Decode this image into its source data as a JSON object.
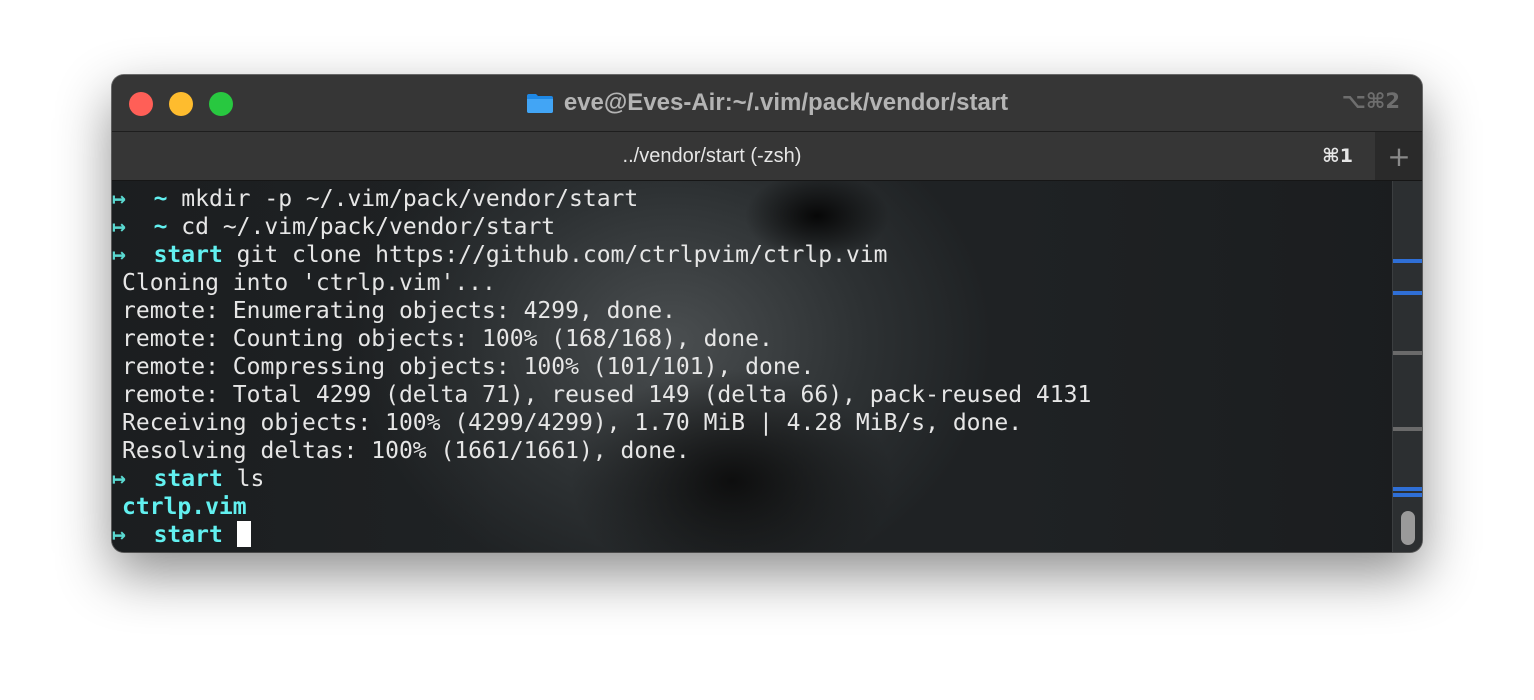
{
  "window": {
    "title": "eve@Eves-Air:~/.vim/pack/vendor/start",
    "title_shortcut": "⌥⌘2",
    "folder_icon": "folder-icon"
  },
  "tab": {
    "label": "../vendor/start (-zsh)",
    "shortcut": "⌘1",
    "new_tab": "+"
  },
  "terminal": {
    "lines": [
      {
        "type": "prompt",
        "arrow": "↦",
        "cwd": "~",
        "command": "mkdir -p ~/.vim/pack/vendor/start"
      },
      {
        "type": "prompt",
        "arrow": "↦",
        "cwd": "~",
        "command": "cd ~/.vim/pack/vendor/start"
      },
      {
        "type": "prompt",
        "arrow": "↦",
        "cwd": "start",
        "command": "git clone https://github.com/ctrlpvim/ctrlp.vim"
      },
      {
        "type": "output",
        "text": "Cloning into 'ctrlp.vim'..."
      },
      {
        "type": "output",
        "text": "remote: Enumerating objects: 4299, done."
      },
      {
        "type": "output",
        "text": "remote: Counting objects: 100% (168/168), done."
      },
      {
        "type": "output",
        "text": "remote: Compressing objects: 100% (101/101), done."
      },
      {
        "type": "output",
        "text": "remote: Total 4299 (delta 71), reused 149 (delta 66), pack-reused 4131"
      },
      {
        "type": "output",
        "text": "Receiving objects: 100% (4299/4299), 1.70 MiB | 4.28 MiB/s, done."
      },
      {
        "type": "output",
        "text": "Resolving deltas: 100% (1661/1661), done."
      },
      {
        "type": "prompt",
        "arrow": "↦",
        "cwd": "start",
        "command": "ls"
      },
      {
        "type": "dir",
        "text": "ctrlp.vim"
      },
      {
        "type": "prompt",
        "arrow": "↦",
        "cwd": "start",
        "command": "",
        "cursor": true
      }
    ]
  },
  "colors": {
    "prompt_arrow": "#5ad9d1",
    "cwd": "#62f0f0",
    "text": "#e6e6e6",
    "mark_blue": "#2f6fd6",
    "mark_gray": "#6a6a6a",
    "mark_red": "#d64040"
  }
}
